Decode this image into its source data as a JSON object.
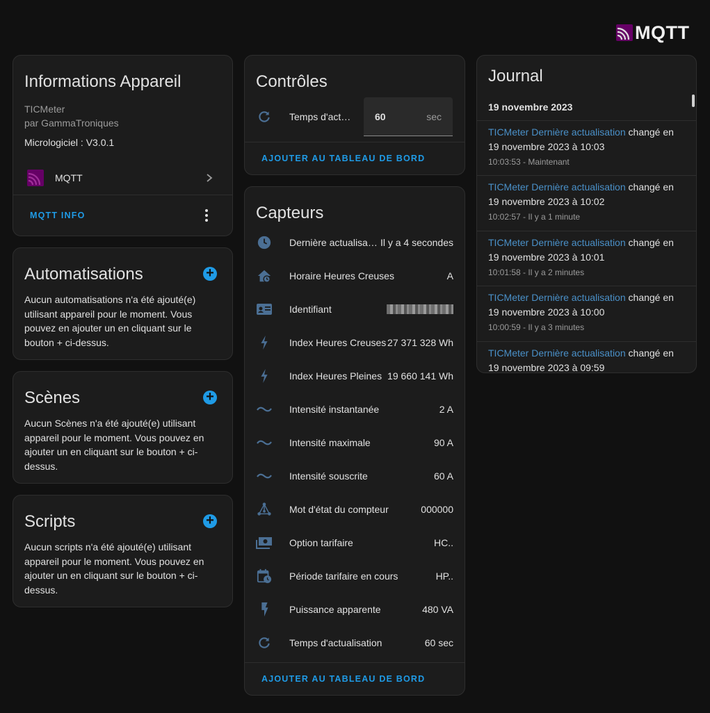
{
  "logo": {
    "text": "MQTT",
    "accent": "#660066"
  },
  "device_info": {
    "title": "Informations Appareil",
    "model": "TICMeter",
    "manufacturer": "par GammaTroniques",
    "firmware": "Micrologiciel : V3.0.1",
    "integration": "MQTT",
    "action_label": "MQTT INFO"
  },
  "automations": {
    "title": "Automatisations",
    "description": "Aucun automatisations n'a été ajouté(e) utilisant appareil pour le moment. Vous pouvez en ajouter un en cliquant sur le bouton + ci-dessus."
  },
  "scenes": {
    "title": "Scènes",
    "description": "Aucun Scènes n'a été ajouté(e) utilisant appareil pour le moment. Vous pouvez en ajouter un en cliquant sur le bouton + ci-dessus."
  },
  "scripts": {
    "title": "Scripts",
    "description": "Aucun scripts n'a été ajouté(e) utilisant appareil pour le moment. Vous pouvez en ajouter un en cliquant sur le bouton + ci-dessus."
  },
  "controls": {
    "title": "Contrôles",
    "row_label": "Temps d'act…",
    "row_value": "60",
    "row_unit": "sec",
    "add_label": "AJOUTER AU TABLEAU DE BORD"
  },
  "sensors": {
    "title": "Capteurs",
    "add_label": "AJOUTER AU TABLEAU DE BORD",
    "rows": [
      {
        "icon": "clock-icon",
        "name": "Dernière actualisa…",
        "value": "Il y a 4 secondes"
      },
      {
        "icon": "home-clock-icon",
        "name": "Horaire Heures Creuses",
        "value": "A"
      },
      {
        "icon": "id-card-icon",
        "name": "Identifiant",
        "value": ""
      },
      {
        "icon": "lightning-icon",
        "name": "Index Heures Creuses",
        "value": "27 371 328 Wh"
      },
      {
        "icon": "lightning-icon",
        "name": "Index Heures Pleines",
        "value": "19 660 141 Wh"
      },
      {
        "icon": "current-ac-icon",
        "name": "Intensité instantanée",
        "value": "2 A"
      },
      {
        "icon": "current-ac-icon",
        "name": "Intensité maximale",
        "value": "90 A"
      },
      {
        "icon": "current-ac-icon",
        "name": "Intensité souscrite",
        "value": "60 A"
      },
      {
        "icon": "graph-icon",
        "name": "Mot d'état du compteur",
        "value": "000000"
      },
      {
        "icon": "cash-icon",
        "name": "Option tarifaire",
        "value": "HC.."
      },
      {
        "icon": "calendar-clock-icon",
        "name": "Période tarifaire en cours",
        "value": "HP.."
      },
      {
        "icon": "flash-icon",
        "name": "Puissance apparente",
        "value": "480 VA"
      },
      {
        "icon": "refresh-icon",
        "name": "Temps d'actualisation",
        "value": "60 sec"
      }
    ]
  },
  "journal": {
    "title": "Journal",
    "date_header": "19 novembre 2023",
    "entries": [
      {
        "entity": "TICMeter Dernière actualisation",
        "verb": "changé en",
        "value": "19 novembre 2023 à 10:03",
        "when": "10:03:53 - Maintenant"
      },
      {
        "entity": "TICMeter Dernière actualisation",
        "verb": "changé en",
        "value": "19 novembre 2023 à 10:02",
        "when": "10:02:57 - Il y a 1 minute"
      },
      {
        "entity": "TICMeter Dernière actualisation",
        "verb": "changé en",
        "value": "19 novembre 2023 à 10:01",
        "when": "10:01:58 - Il y a 2 minutes"
      },
      {
        "entity": "TICMeter Dernière actualisation",
        "verb": "changé en",
        "value": "19 novembre 2023 à 10:00",
        "when": "10:00:59 - Il y a 3 minutes"
      },
      {
        "entity": "TICMeter Dernière actualisation",
        "verb": "changé en",
        "value": "19 novembre 2023 à 09:59",
        "when": ""
      }
    ]
  }
}
